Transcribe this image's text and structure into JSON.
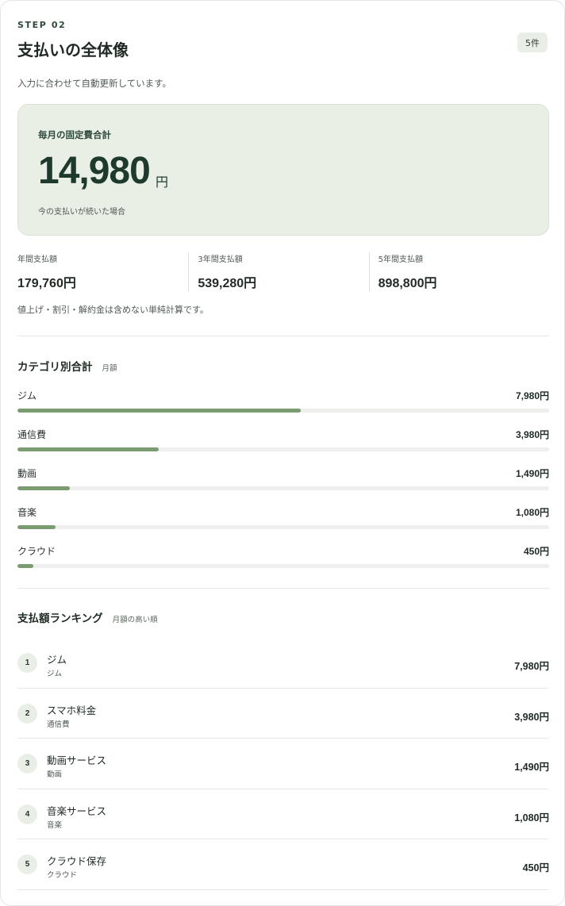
{
  "header": {
    "step": "STEP 02",
    "title": "支払いの全体像",
    "count_badge": "5件",
    "subtitle": "入力に合わせて自動更新しています。"
  },
  "monthly_total": {
    "label": "毎月の固定費合計",
    "amount": "14,980",
    "unit": "円",
    "note": "今の支払いが続いた場合"
  },
  "projections": [
    {
      "label": "年間支払額",
      "value": "179,760円"
    },
    {
      "label": "3年間支払額",
      "value": "539,280円"
    },
    {
      "label": "5年間支払額",
      "value": "898,800円"
    }
  ],
  "disclaimer": "値上げ・割引・解約金は含めない単純計算です。",
  "categories": {
    "title": "カテゴリ別合計",
    "subtitle": "月額",
    "items": [
      {
        "name": "ジム",
        "amount": "7,980円",
        "share": 0.533
      },
      {
        "name": "通信費",
        "amount": "3,980円",
        "share": 0.266
      },
      {
        "name": "動画",
        "amount": "1,490円",
        "share": 0.099
      },
      {
        "name": "音楽",
        "amount": "1,080円",
        "share": 0.072
      },
      {
        "name": "クラウド",
        "amount": "450円",
        "share": 0.03
      }
    ]
  },
  "ranking": {
    "title": "支払額ランキング",
    "subtitle": "月額の高い順",
    "items": [
      {
        "rank": "1",
        "name": "ジム",
        "category": "ジム",
        "amount": "7,980円"
      },
      {
        "rank": "2",
        "name": "スマホ料金",
        "category": "通信費",
        "amount": "3,980円"
      },
      {
        "rank": "3",
        "name": "動画サービス",
        "category": "動画",
        "amount": "1,490円"
      },
      {
        "rank": "4",
        "name": "音楽サービス",
        "category": "音楽",
        "amount": "1,080円"
      },
      {
        "rank": "5",
        "name": "クラウド保存",
        "category": "クラウド",
        "amount": "450円"
      }
    ]
  },
  "colors": {
    "accent": "#7b9b70",
    "panel": "#e9efe5",
    "text": "#1f2a24"
  }
}
